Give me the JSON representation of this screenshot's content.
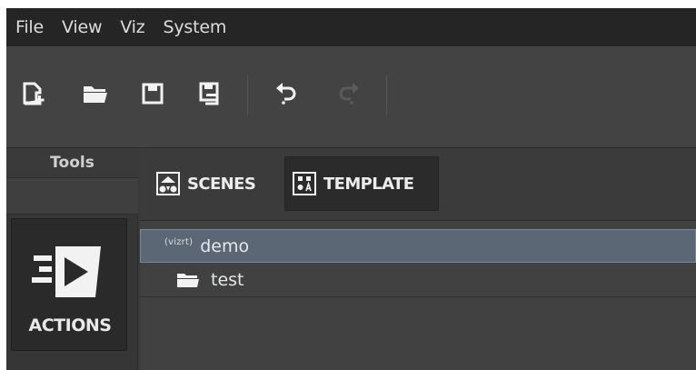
{
  "menu": {
    "items": [
      {
        "label": "File"
      },
      {
        "label": "View"
      },
      {
        "label": "Viz"
      },
      {
        "label": "System"
      }
    ]
  },
  "toolbar": {
    "buttons": [
      {
        "icon": "new-file-icon"
      },
      {
        "icon": "open-folder-icon"
      },
      {
        "icon": "save-icon"
      },
      {
        "icon": "save-as-icon"
      },
      {
        "icon": "undo-icon"
      },
      {
        "icon": "redo-icon",
        "disabled": true
      }
    ]
  },
  "tools": {
    "title": "Tools",
    "actions_label": "ACTIONS"
  },
  "tabs": [
    {
      "label": "SCENES",
      "active": false,
      "icon": "scenes-icon"
    },
    {
      "label": "TEMPLATE",
      "active": true,
      "icon": "template-icon"
    }
  ],
  "tree": {
    "items": [
      {
        "prefix": "(vizrt)",
        "label": "demo",
        "selected": true
      },
      {
        "label": "test",
        "icon": "folder-icon",
        "selected": false
      }
    ]
  },
  "colors": {
    "selection": "#5c6776",
    "menubar": "#252525",
    "toolbar": "#434343"
  }
}
